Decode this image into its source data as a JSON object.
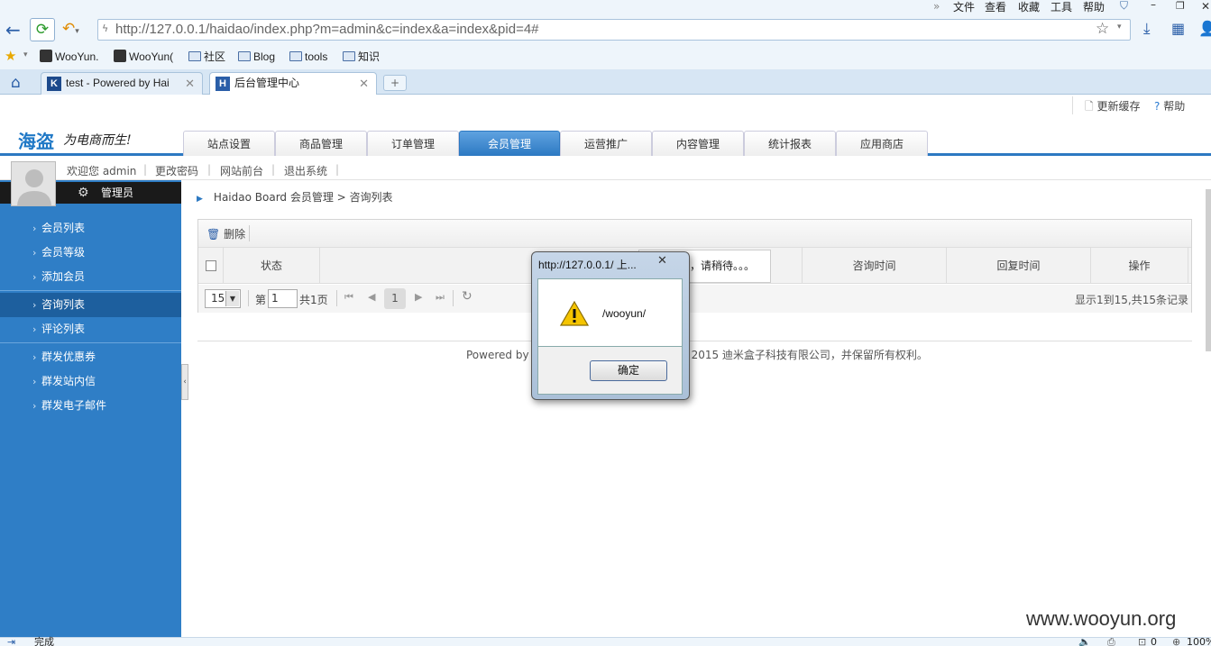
{
  "browser": {
    "menu": [
      "文件",
      "查看",
      "收藏",
      "工具",
      "帮助"
    ],
    "address": "http://127.0.0.1/haidao/index.php?m=admin&c=index&a=index&pid=4#",
    "bookmarks": [
      "WooYun.",
      "WooYun(",
      "社区",
      "Blog",
      "tools",
      "知识"
    ],
    "tabs": [
      "test - Powered by Hai",
      "后台管理中心"
    ],
    "status": "完成",
    "zoom": "100%",
    "counter": "0"
  },
  "header": {
    "logo": "海盗",
    "slogan": "为电商而生!",
    "refresh_cache": "更新缓存",
    "help": "帮助",
    "nav": [
      "站点设置",
      "商品管理",
      "订单管理",
      "会员管理",
      "运营推广",
      "内容管理",
      "统计报表",
      "应用商店"
    ],
    "active_nav": "会员管理"
  },
  "userbar": {
    "welcome": "欢迎您 admin",
    "links": [
      "更改密码",
      "网站前台",
      "退出系统"
    ]
  },
  "sidebar": {
    "role": "管理员",
    "groups": [
      [
        "会员列表",
        "会员等级",
        "添加会员"
      ],
      [
        "咨询列表",
        "评论列表"
      ],
      [
        "群发优惠券",
        "群发站内信",
        "群发电子邮件"
      ]
    ],
    "active": "咨询列表"
  },
  "main": {
    "breadcrumb": "Haidao Board 会员管理 > 咨询列表",
    "delete": "删除",
    "columns": [
      "状态",
      "咨询时间",
      "回复时间",
      "操作"
    ],
    "page_size": "15",
    "page_prefix": "第",
    "page_value": "1",
    "page_suffix": "共1页",
    "current_page": "1",
    "summary": "显示1到15,共15条记录",
    "loading": "，请稍待。。。"
  },
  "footer": {
    "left": "Powered by",
    "right": "2015 迪米盒子科技有限公司，并保留所有权利。"
  },
  "dialog": {
    "title": "http://127.0.0.1/ 上...",
    "message": "/wooyun/",
    "ok": "确定"
  },
  "watermark": "www.wooyun.org",
  "colors": {
    "accent": "#2c79c2",
    "sidebar": "#2f7ec6",
    "chrome": "#eef5fb"
  }
}
